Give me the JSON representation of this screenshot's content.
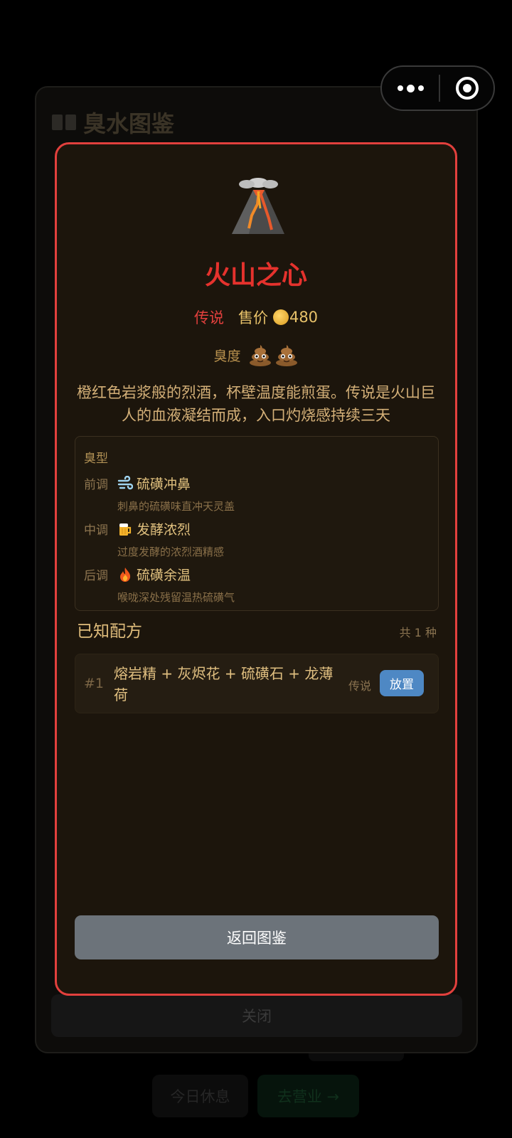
{
  "background": {
    "rest_button": "今日休息",
    "go_button": "去营业 →"
  },
  "capsule": {
    "more_icon": "more-dots-icon",
    "close_icon": "target-circle-icon"
  },
  "codex": {
    "title": "臭水图鉴",
    "title_icon": "open-book-icon",
    "close_label": "关闭"
  },
  "detail": {
    "icon": "volcano-icon",
    "name": "火山之心",
    "rarity": "传说",
    "price_label": "售价",
    "price_value": "480",
    "stink_label": "臭度",
    "stink_level": 2,
    "description": "橙红色岩浆般的烈酒，杯壁温度能煎蛋。传说是火山巨人的血液凝结而成，入口灼烧感持续三天",
    "scent": {
      "title": "臭型",
      "notes": [
        {
          "label": "前调",
          "icon": "wind-icon",
          "name": "硫磺冲鼻",
          "desc": "刺鼻的硫磺味直冲天灵盖"
        },
        {
          "label": "中调",
          "icon": "beer-mug-icon",
          "name": "发酵浓烈",
          "desc": "过度发酵的浓烈酒精感"
        },
        {
          "label": "后调",
          "icon": "fire-icon",
          "name": "硫磺余温",
          "desc": "喉咙深处残留温热硫磺气"
        }
      ]
    },
    "recipes_title": "已知配方",
    "recipes_count": "共 1 种",
    "recipes": [
      {
        "index": "#1",
        "text": "熔岩精 + 灰烬花 + 硫磺石 + 龙薄荷",
        "rarity": "传说",
        "action": "放置"
      }
    ],
    "back_label": "返回图鉴"
  },
  "colors": {
    "accent_red": "#e2403d",
    "gold_text": "#e0bf80",
    "place_button": "#4e88c4",
    "back_button": "#6c737a"
  }
}
